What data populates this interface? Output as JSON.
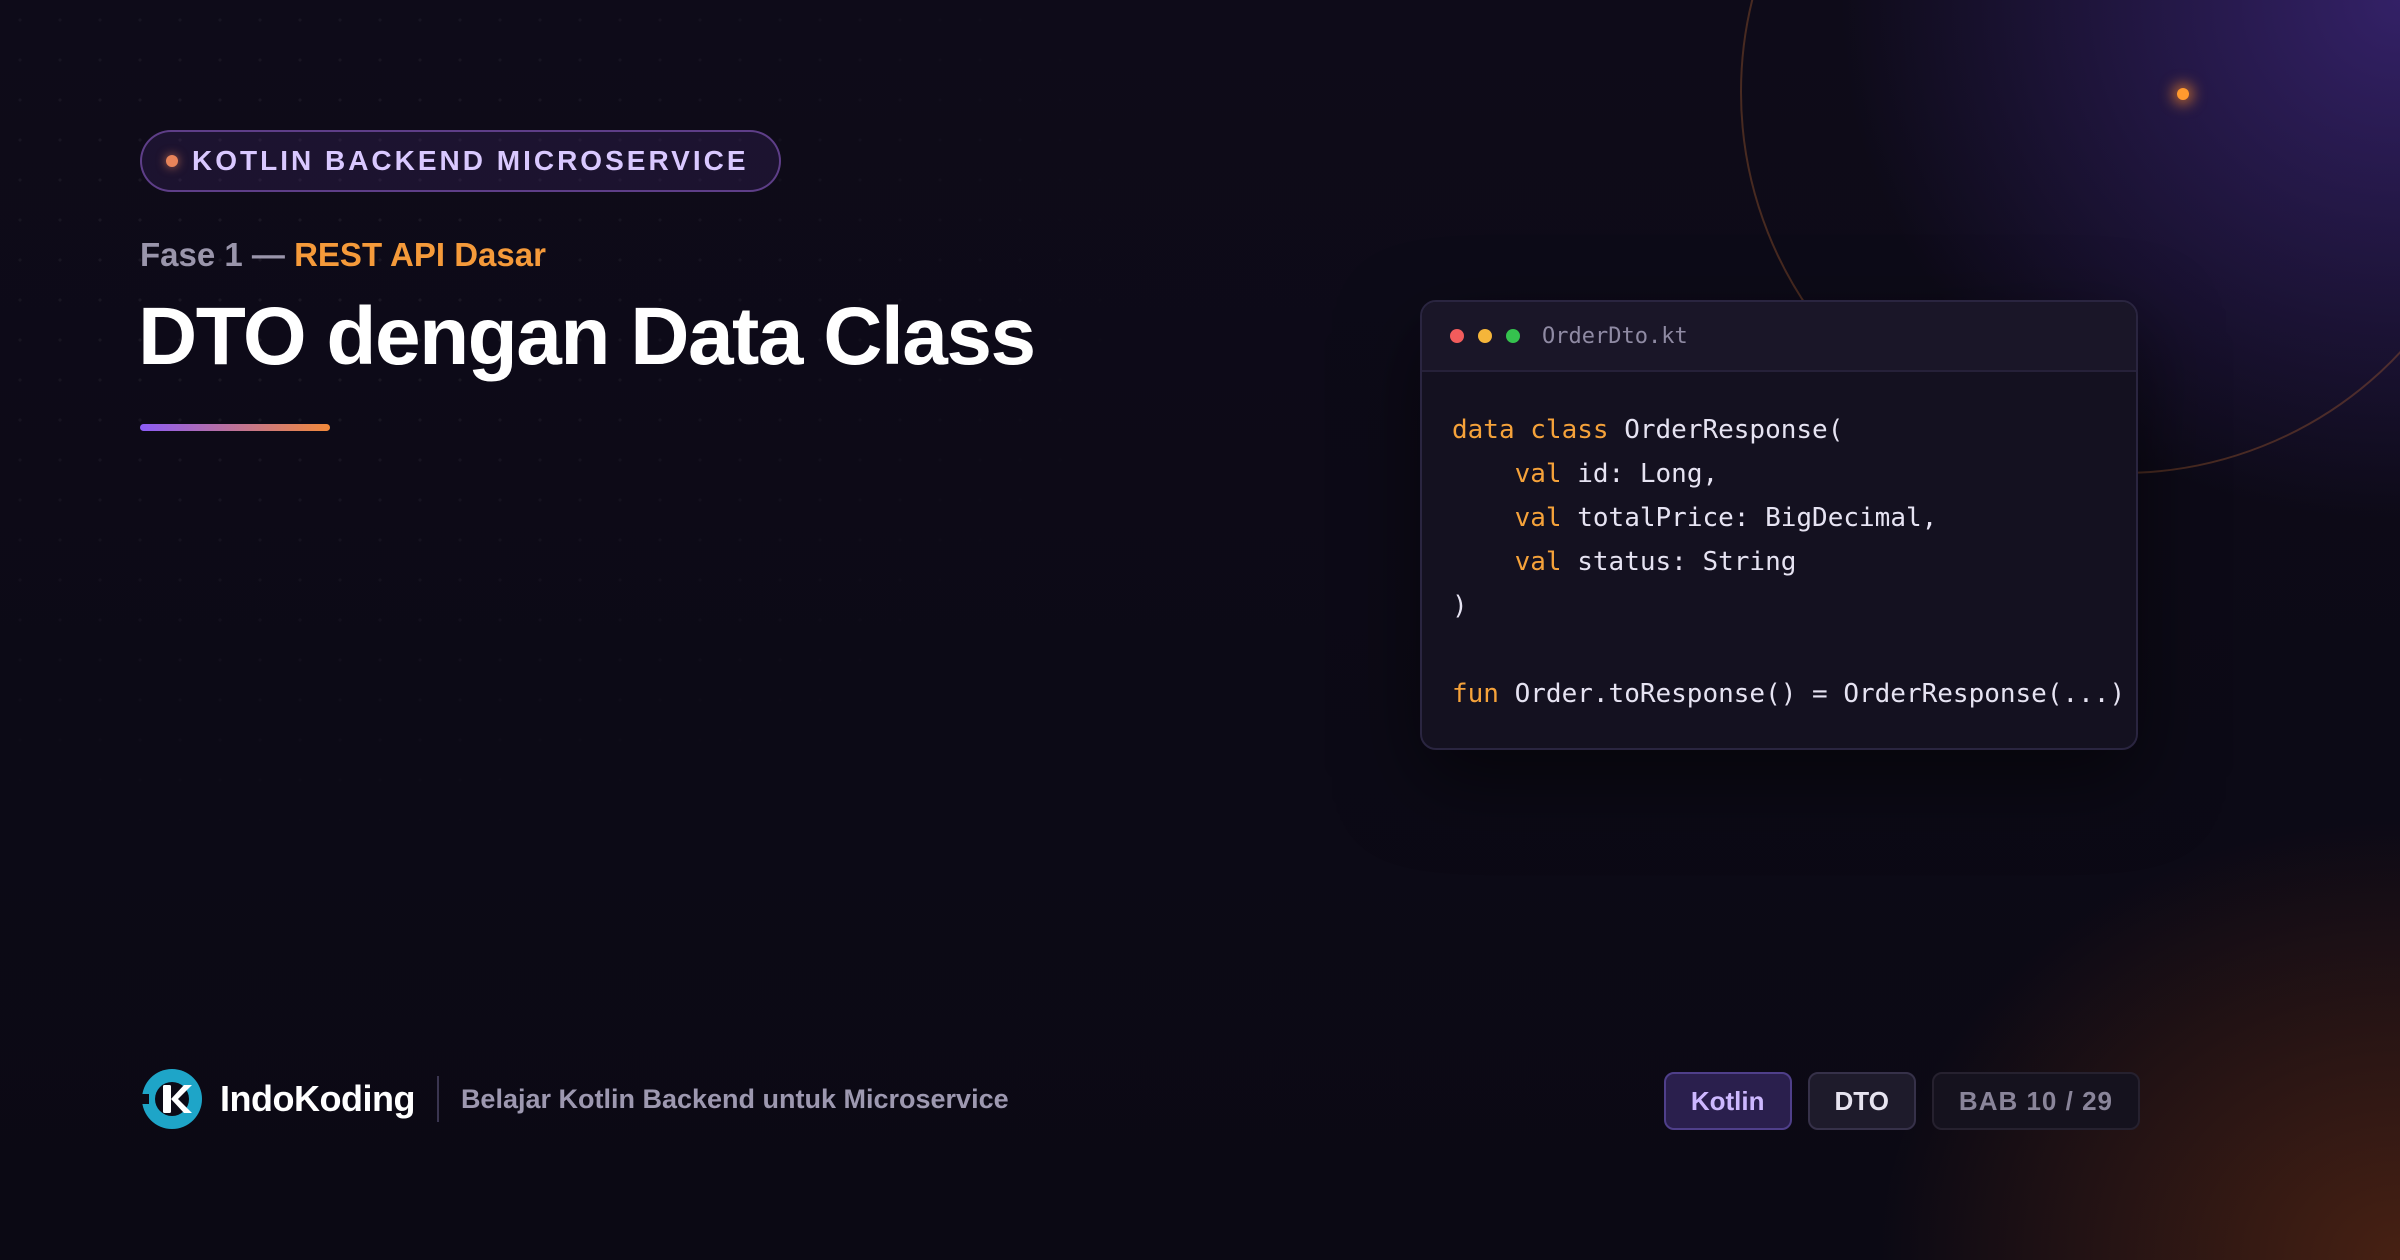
{
  "header": {
    "pill_label": "KOTLIN BACKEND MICROSERVICE",
    "phase_prefix": "Fase 1 —",
    "phase_name": "REST API Dasar",
    "title": "DTO dengan Data Class"
  },
  "code_card": {
    "filename": "OrderDto.kt",
    "lines": [
      [
        {
          "t": "data class",
          "k": true
        },
        {
          "t": " OrderResponse("
        }
      ],
      [
        {
          "t": "    "
        },
        {
          "t": "val",
          "k": true
        },
        {
          "t": " id: Long,"
        }
      ],
      [
        {
          "t": "    "
        },
        {
          "t": "val",
          "k": true
        },
        {
          "t": " totalPrice: BigDecimal,"
        }
      ],
      [
        {
          "t": "    "
        },
        {
          "t": "val",
          "k": true
        },
        {
          "t": " status: String"
        }
      ],
      [
        {
          "t": ")"
        }
      ],
      [],
      [
        {
          "t": "fun",
          "k": true
        },
        {
          "t": " Order.toResponse() = OrderResponse(...)"
        }
      ]
    ]
  },
  "footer": {
    "brand_name": "IndoKoding",
    "tagline": "Belajar Kotlin Backend untuk Microservice",
    "tags": [
      "Kotlin",
      "DTO"
    ],
    "chapter": "BAB 10 / 29"
  },
  "colors": {
    "accent_orange": "#f59a3a",
    "accent_purple": "#8b5cf6",
    "background": "#0c0a16",
    "logo_cyan": "#1ea5c8"
  },
  "icons": [
    "indokoding-logo-icon",
    "window-close-dot-icon",
    "window-minimize-dot-icon",
    "window-maximize-dot-icon"
  ]
}
